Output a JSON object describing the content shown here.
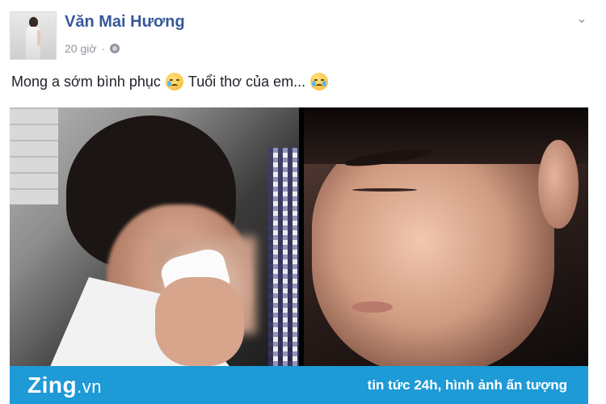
{
  "post": {
    "author": "Văn Mai Hương",
    "time": "20 giờ",
    "separator": "·",
    "caption_part1": "Mong a sớm bình phục",
    "caption_part2": "Tuổi thơ của em...",
    "emoji1": "disappointed-relieved-face-icon",
    "emoji2": "loudly-crying-face-icon"
  },
  "banner": {
    "logo_zing": "Zing",
    "logo_vn": ".vn",
    "slogan": "tin tức 24h, hình ảnh ấn tượng",
    "color": "#1e9ad6"
  },
  "colors": {
    "author": "#365899",
    "meta": "#90949c",
    "text": "#1d2129"
  }
}
